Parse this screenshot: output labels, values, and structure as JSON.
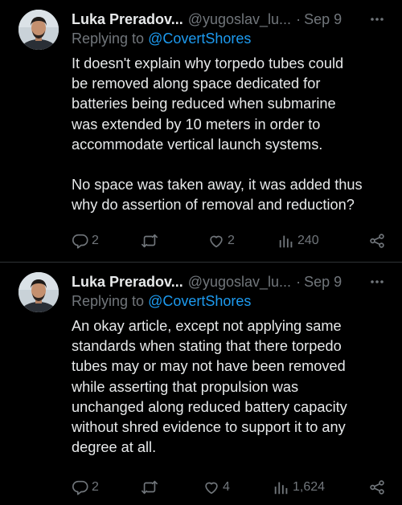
{
  "colors": {
    "background": "#000000",
    "text_primary": "#e7e9ea",
    "text_secondary": "#71767b",
    "mention": "#1d9bf0",
    "divider": "#2f3336"
  },
  "tweets": [
    {
      "author": {
        "display_name": "Luka Preradov...",
        "handle": "@yugoslav_lu...",
        "avatar": "avatar-photo"
      },
      "separator": "·",
      "date": "Sep 9",
      "more_icon": "ellipsis-icon",
      "replying_prefix": "Replying to",
      "replying_to": "@CovertShores",
      "body": [
        [
          "It doesn't explain why torpedo tubes could",
          "be removed along space dedicated for",
          "batteries being reduced when submarine",
          "was extended by 10 meters in order to",
          "accommodate vertical launch systems."
        ],
        [
          "No space was taken away, it was added thus",
          "why do assertion of removal and reduction?"
        ]
      ],
      "stats": {
        "replies": "2",
        "retweets": "",
        "likes": "2",
        "views": "240"
      }
    },
    {
      "author": {
        "display_name": "Luka Preradov...",
        "handle": "@yugoslav_lu...",
        "avatar": "avatar-photo"
      },
      "separator": "·",
      "date": "Sep 9",
      "more_icon": "ellipsis-icon",
      "replying_prefix": "Replying to",
      "replying_to": "@CovertShores",
      "body": [
        [
          "An okay article, except not applying same",
          "standards when stating that there torpedo",
          "tubes may or may not have been removed",
          "while asserting that propulsion was",
          "unchanged along reduced battery capacity",
          "without shred evidence to support it to any",
          "degree at all."
        ]
      ],
      "stats": {
        "replies": "2",
        "retweets": "",
        "likes": "4",
        "views": "1,624"
      }
    }
  ]
}
